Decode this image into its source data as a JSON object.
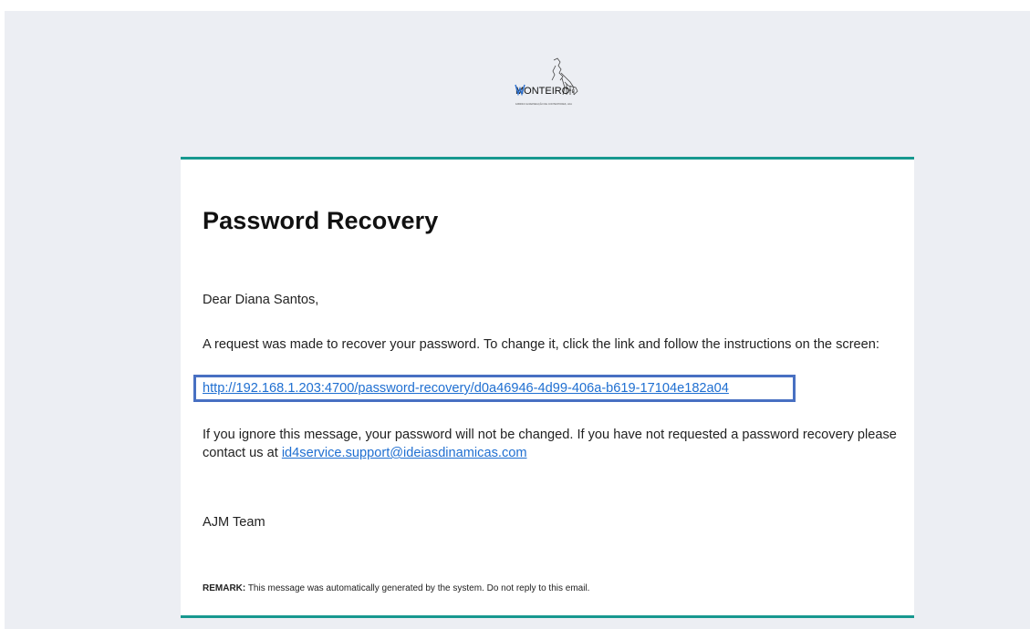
{
  "logo": {
    "text": "MONTEIRO",
    "subtitle": "FABRICO E REPARAÇÃO DE CONTENTORES, LDA",
    "icon": "monteiro-logo"
  },
  "email": {
    "title": "Password Recovery",
    "greeting": "Dear Diana Santos,",
    "request_text": "A request was made to recover your password. To change it, click the link and follow the instructions on the screen:",
    "recovery_link": "http://192.168.1.203:4700/password-recovery/d0a46946-4d99-406a-b619-17104e182a04",
    "ignore_text": "If you ignore this message, your password will not be changed. If you have not requested a password recovery please contact us at",
    "support_email": "id4service.support@ideiasdinamicas.com",
    "signature": "AJM Team",
    "remark_label": "REMARK:",
    "remark_text": "This message was automatically generated by the system. Do not reply to this email."
  },
  "colors": {
    "background": "#eceef3",
    "card": "#ffffff",
    "accent_border": "#17988f",
    "link": "#1f6fd1",
    "highlight_box": "#4870c2"
  }
}
